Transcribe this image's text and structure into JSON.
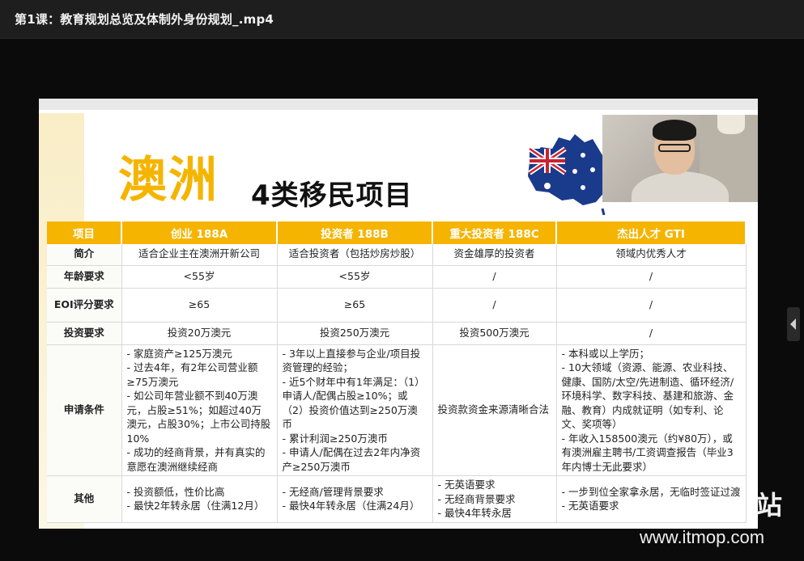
{
  "window": {
    "title": "第1课：教育规划总览及体制外身份规划_.mp4"
  },
  "slide": {
    "heading_big": "澳洲",
    "heading_small": "4类移民项目",
    "table": {
      "headers": [
        "项目",
        "创业 188A",
        "投资者 188B",
        "重大投资者 188C",
        "杰出人才 GTI"
      ],
      "rows": [
        {
          "label": "简介",
          "cells": [
            "适合企业主在澳洲开新公司",
            "适合投资者（包括炒房炒股）",
            "资金雄厚的投资者",
            "领域内优秀人才"
          ]
        },
        {
          "label": "年龄要求",
          "cells": [
            "<55岁",
            "<55岁",
            "/",
            "/"
          ]
        },
        {
          "label": "EOI评分要求",
          "cells": [
            "≥65",
            "≥65",
            "/",
            "/"
          ]
        },
        {
          "label": "投资要求",
          "cells": [
            "投资20万澳元",
            "投资250万澳元",
            "投资500万澳元",
            "/"
          ]
        }
      ],
      "apply": {
        "label": "申请条件",
        "c1": [
          "- 家庭资产≥125万澳元",
          "- 过去4年，有2年公司营业额≥75万澳元",
          "- 如公司年营业额不到40万澳元，占股≥51%；如超过40万澳元，占股30%；上市公司持股10%",
          "- 成功的经商背景，并有真实的意愿在澳洲继续经商"
        ],
        "c2": [
          "- 3年以上直接参与企业/项目投资管理的经验；",
          "- 近5个财年中有1年满足：（1）申请人/配偶占股≥10%；或（2）投资价值达到≥250万澳币",
          "- 累计利润≥250万澳币",
          "- 申请人/配偶在过去2年内净资产≥250万澳币"
        ],
        "c3": "投资款资金来源清晰合法",
        "c4": [
          "- 本科或以上学历；",
          "- 10大领域（资源、能源、农业科技、健康、国防/太空/先进制造、循环经济/环境科学、数字科技、基建和旅游、金融、教育）内成就证明（如专利、论文、奖项等）",
          "- 年收入158500澳元（约¥80万），或有澳洲雇主聘书/工资调查报告（毕业3年内博士无此要求）"
        ]
      },
      "other": {
        "label": "其他",
        "c1": [
          "- 投资额低，性价比高",
          "- 最快2年转永居（住满12月）"
        ],
        "c2": [
          "- 无经商/管理背景要求",
          "- 最快4年转永居（住满24月）"
        ],
        "c3": [
          "- 无英语要求",
          "- 无经商背景要求",
          "- 最快4年转永居"
        ],
        "c4": [
          "- 一步到位全家拿永居，无临时签证过渡",
          "- 无英语要求"
        ]
      }
    }
  },
  "watermark": {
    "zhan": "站",
    "site": "www.itmop.com"
  }
}
